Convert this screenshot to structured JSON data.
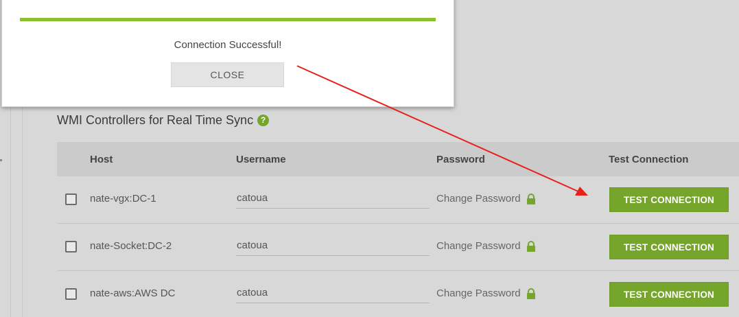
{
  "section": {
    "title": "WMI Controllers for Real Time Sync",
    "help_icon": "?"
  },
  "table": {
    "headers": {
      "host": "Host",
      "username": "Username",
      "password": "Password",
      "test": "Test Connection"
    },
    "rows": [
      {
        "host": "nate-vgx:DC-1",
        "username": "catoua",
        "password_link": "Change Password",
        "test_label": "TEST CONNECTION"
      },
      {
        "host": "nate-Socket:DC-2",
        "username": "catoua",
        "password_link": "Change Password",
        "test_label": "TEST CONNECTION"
      },
      {
        "host": "nate-aws:AWS DC",
        "username": "catoua",
        "password_link": "Change Password",
        "test_label": "TEST CONNECTION"
      }
    ]
  },
  "modal": {
    "message": "Connection Successful!",
    "close_label": "CLOSE"
  },
  "colors": {
    "accent_green": "#76a52b",
    "success_bar": "#8bbf2e",
    "annotation_arrow": "#e8201c"
  },
  "icons": {
    "help": "help-icon",
    "lock": "lock-icon"
  }
}
